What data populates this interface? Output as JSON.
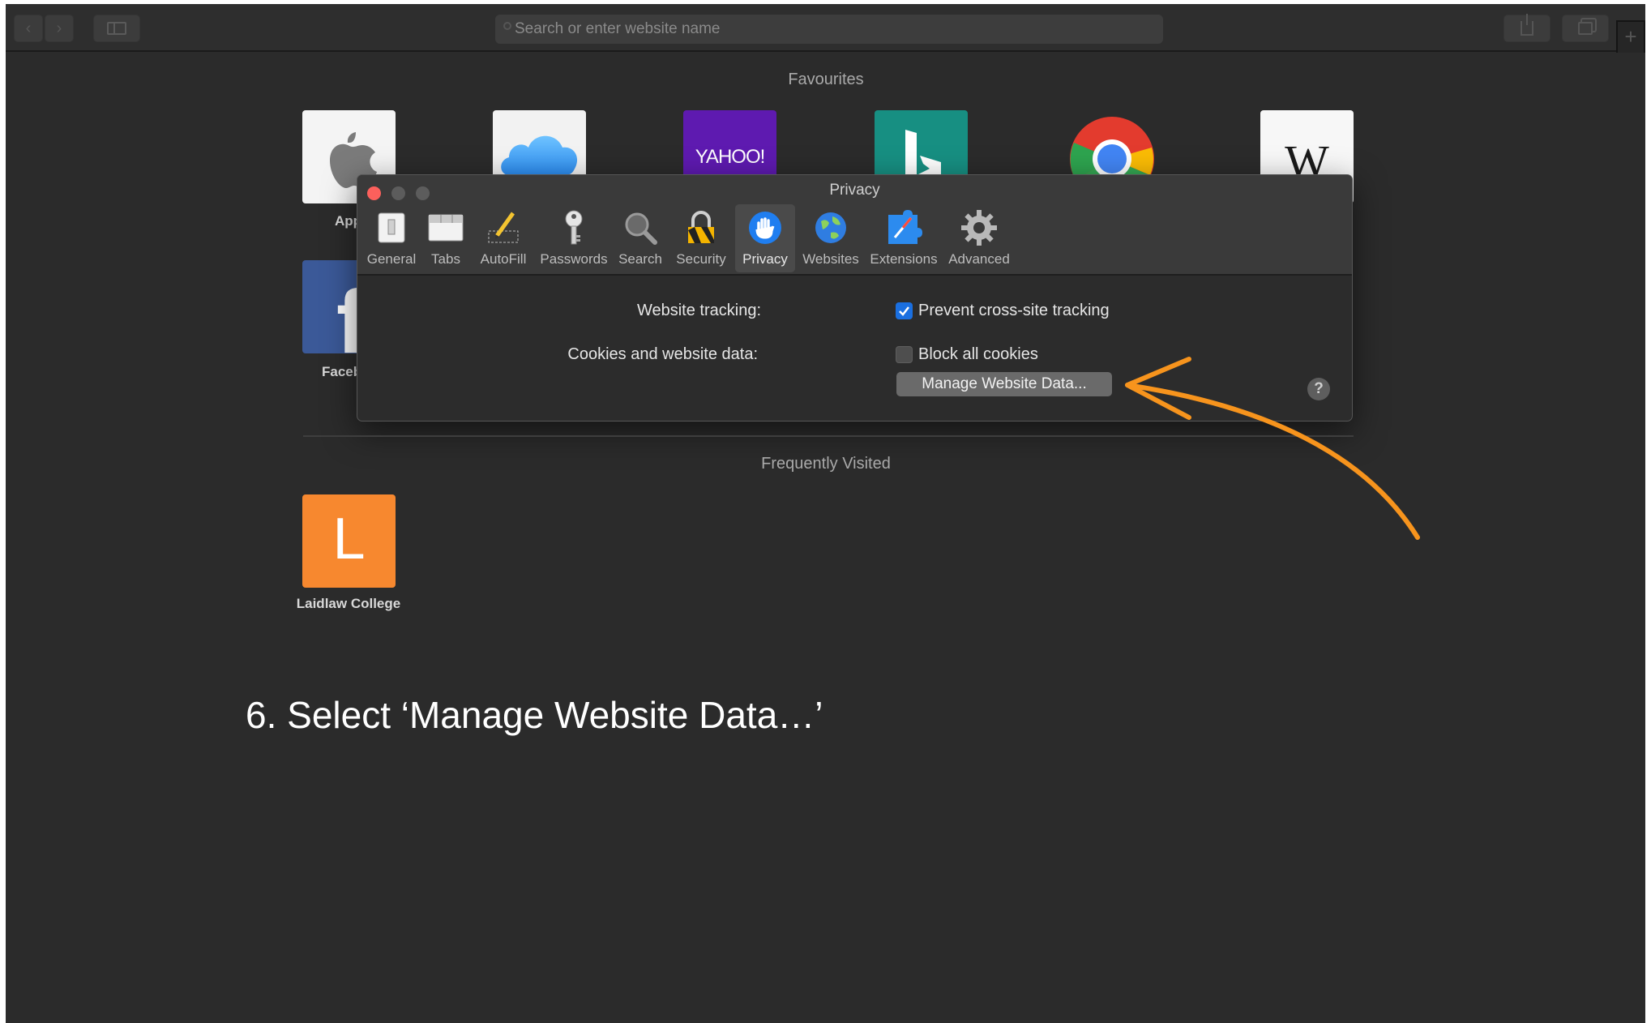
{
  "toolbar": {
    "search_placeholder": "Search or enter website name"
  },
  "favourites": {
    "heading": "Favourites",
    "tiles": [
      {
        "label": "App",
        "icon": "apple-icon"
      },
      {
        "label": "",
        "icon": "icloud-icon"
      },
      {
        "label": "",
        "icon": "yahoo-logo",
        "logo_text": "YAHOO!"
      },
      {
        "label": "",
        "icon": "bing-icon"
      },
      {
        "label": "",
        "icon": "chrome-icon"
      },
      {
        "label": "",
        "icon": "wikipedia-icon",
        "logo_text": "W"
      },
      {
        "label": "Faceb",
        "icon": "facebook-icon"
      }
    ]
  },
  "privacy_window": {
    "title": "Privacy",
    "tabs": [
      {
        "label": "General",
        "icon": "switch-icon"
      },
      {
        "label": "Tabs",
        "icon": "tabs-icon"
      },
      {
        "label": "AutoFill",
        "icon": "pencil-icon"
      },
      {
        "label": "Passwords",
        "icon": "key-icon"
      },
      {
        "label": "Search",
        "icon": "magnifier-icon"
      },
      {
        "label": "Security",
        "icon": "lock-icon"
      },
      {
        "label": "Privacy",
        "icon": "hand-icon",
        "active": true
      },
      {
        "label": "Websites",
        "icon": "globe-icon"
      },
      {
        "label": "Extensions",
        "icon": "puzzle-compass-icon"
      },
      {
        "label": "Advanced",
        "icon": "gear-icon"
      }
    ],
    "website_tracking_label": "Website tracking:",
    "prevent_tracking_label": "Prevent cross-site tracking",
    "prevent_tracking_checked": true,
    "cookies_label": "Cookies and website data:",
    "block_cookies_label": "Block all cookies",
    "block_cookies_checked": false,
    "manage_button_label": "Manage Website Data...",
    "help_label": "?"
  },
  "frequently_visited": {
    "heading": "Frequently Visited",
    "tiles": [
      {
        "label": "Laidlaw College",
        "letter": "L",
        "color": "#f7882f"
      }
    ]
  },
  "instruction": "6. Select ‘Manage Website Data…’",
  "colors": {
    "accent_arrow": "#f7941d",
    "checkbox_checked": "#1a6fe0",
    "close_light": "#fc605c"
  }
}
